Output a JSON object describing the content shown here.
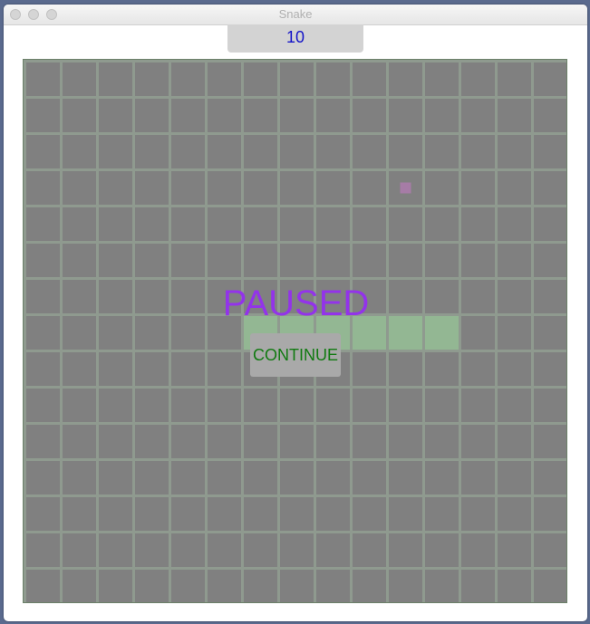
{
  "window": {
    "title": "Snake"
  },
  "score": "10",
  "overlay": {
    "paused_label": "PAUSED",
    "continue_label": "CONTINUE"
  },
  "board": {
    "cols": 15,
    "rows": 15,
    "colors": {
      "cell": "#808080",
      "grid_line": "#8f9a8f",
      "snake": "#93b793",
      "food": "#a67ca6"
    },
    "snake": [
      [
        6,
        7
      ],
      [
        7,
        7
      ],
      [
        8,
        7
      ],
      [
        9,
        7
      ],
      [
        10,
        7
      ],
      [
        11,
        7
      ]
    ],
    "food": [
      10,
      3
    ]
  }
}
